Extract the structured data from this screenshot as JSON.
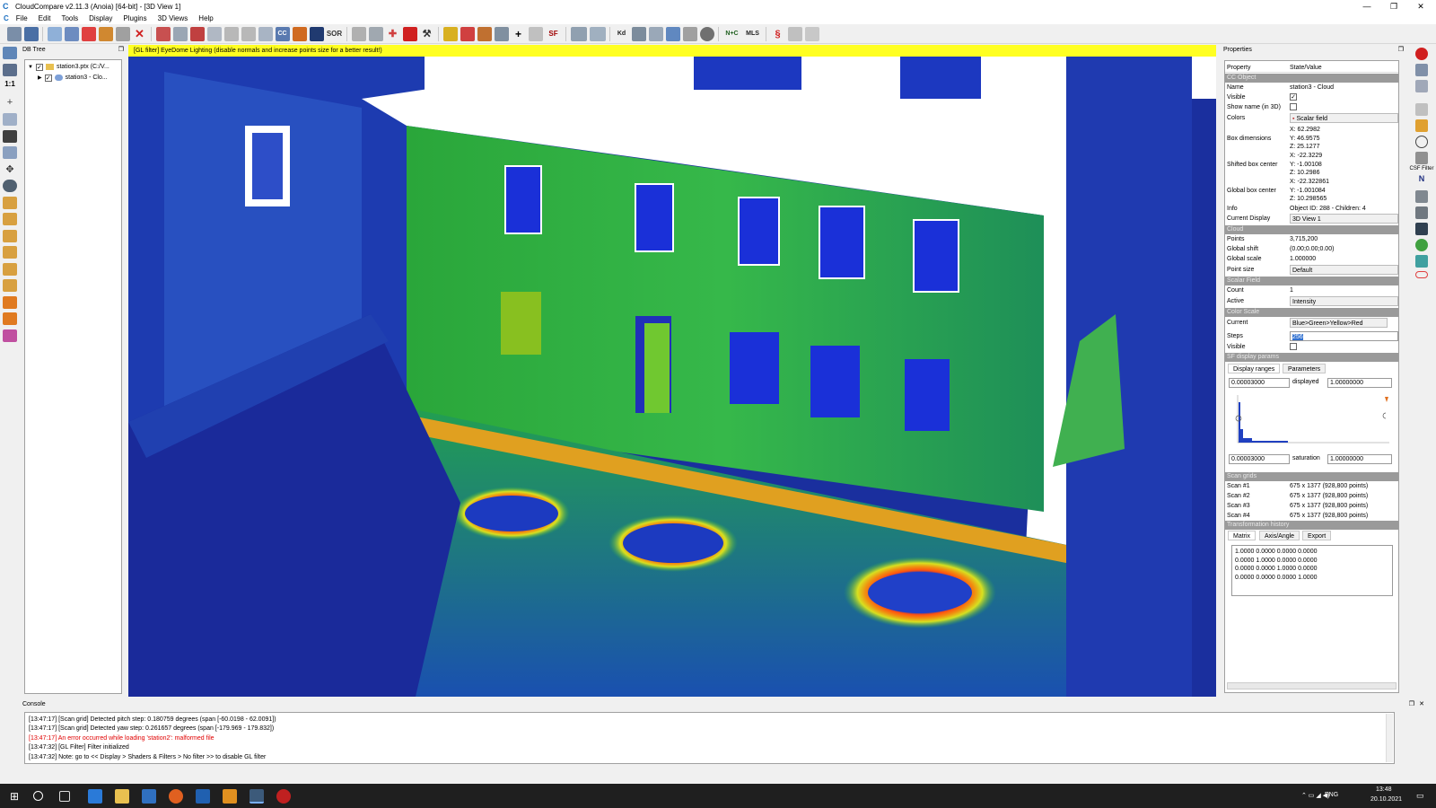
{
  "window": {
    "title": "CloudCompare v2.11.3 (Anoia) [64-bit] - [3D View 1]",
    "app_icon": "C",
    "controls": [
      "—",
      "❐",
      "✕"
    ]
  },
  "menu": [
    "File",
    "Edit",
    "Tools",
    "Display",
    "Plugins",
    "3D Views",
    "Help"
  ],
  "toolbar_labels": {
    "sor": "SOR",
    "sf": "SF",
    "kd": "Kd",
    "nc": "N+C",
    "mls": "MLS"
  },
  "db_tree": {
    "title": "DB Tree",
    "items": [
      {
        "label": "station3.ptx (C:/V..."
      },
      {
        "label": "station3 - Clo..."
      }
    ]
  },
  "gl_filter_message": "[GL filter] EyeDome Lighting (disable normals and increase points size for a better result!)",
  "properties": {
    "title": "Properties",
    "header": {
      "k": "Property",
      "v": "State/Value"
    },
    "sections": {
      "cc_object": "CC Object",
      "cloud": "Cloud",
      "scalar_field": "Scalar Field",
      "color_scale": "Color Scale",
      "sf_display": "SF display params",
      "scan_grids": "Scan grids",
      "transformation": "Transformation history"
    },
    "cc": {
      "name_k": "Name",
      "name_v": "station3 - Cloud",
      "visible_k": "Visible",
      "showname_k": "Show name (in 3D)",
      "colors_k": "Colors",
      "colors_v": "Scalar field",
      "box_k": "Box dimensions",
      "box_x": "X: 62.2982",
      "box_y": "Y: 46.9575",
      "box_z": "Z: 25.1277",
      "sbc_k": "Shifted box center",
      "sbc_x": "X: -22.3229",
      "sbc_y": "Y: -1.00108",
      "sbc_z": "Z: 10.2986",
      "gbc_k": "Global box center",
      "gbc_x": "X: -22.322861",
      "gbc_y": "Y: -1.001084",
      "gbc_z": "Z: 10.298565",
      "info_k": "Info",
      "info_v": "Object ID: 288 - Children: 4",
      "cd_k": "Current Display",
      "cd_v": "3D View 1"
    },
    "cloud": {
      "points_k": "Points",
      "points_v": "3,715,200",
      "shift_k": "Global shift",
      "shift_v": "(0.00;0.00;0.00)",
      "scale_k": "Global scale",
      "scale_v": "1.000000",
      "psize_k": "Point size",
      "psize_v": "Default"
    },
    "sf": {
      "count_k": "Count",
      "count_v": "1",
      "active_k": "Active",
      "active_v": "Intensity"
    },
    "cs": {
      "current_k": "Current",
      "current_v": "Blue>Green>Yellow>Red",
      "steps_k": "Steps",
      "steps_v": "256",
      "visible_k": "Visible"
    },
    "disp": {
      "tab1": "Display ranges",
      "tab2": "Parameters",
      "min1": "0.00003000",
      "displayed": "displayed",
      "max1": "1.00000000",
      "min2": "0.00003000",
      "saturation": "saturation",
      "max2": "1.00000000"
    },
    "scans": [
      {
        "k": "Scan #1",
        "v": "675 x 1377 (928,800 points)"
      },
      {
        "k": "Scan #2",
        "v": "675 x 1377 (928,800 points)"
      },
      {
        "k": "Scan #3",
        "v": "675 x 1377 (928,800 points)"
      },
      {
        "k": "Scan #4",
        "v": "675 x 1377 (928,800 points)"
      }
    ],
    "trans": {
      "tab1": "Matrix",
      "tab2": "Axis/Angle",
      "tab3": "Export",
      "m1": "1.0000 0.0000 0.0000 0.0000",
      "m2": "0.0000 1.0000 0.0000 0.0000",
      "m3": "0.0000 0.0000 1.0000 0.0000",
      "m4": "0.0000 0.0000 0.0000 1.0000"
    }
  },
  "right_panel": {
    "csf_label": "CSF Filter"
  },
  "console": {
    "title": "Console",
    "lines": [
      {
        "text": "[13:47:17] [Scan grid] Detected pitch step: 0.180759 degrees (span [-60.0198 - 62.0091])",
        "color": "#000000"
      },
      {
        "text": "[13:47:17] [Scan grid] Detected yaw step: 0.261657 degrees (span [-179.969 - 179.832])",
        "color": "#000000"
      },
      {
        "text": "[13:47:17] An error occurred while loading 'station2': malformed file",
        "color": "#e00000"
      },
      {
        "text": "[13:47:32] [GL Filter] Filter initialized",
        "color": "#000000"
      },
      {
        "text": "[13:47:32] Note: go to << Display > Shaders & Filters > No filter >> to disable GL filter",
        "color": "#000000"
      }
    ]
  },
  "taskbar": {
    "time": "13:48",
    "date": "20.10.2021",
    "lang": "ENG"
  }
}
